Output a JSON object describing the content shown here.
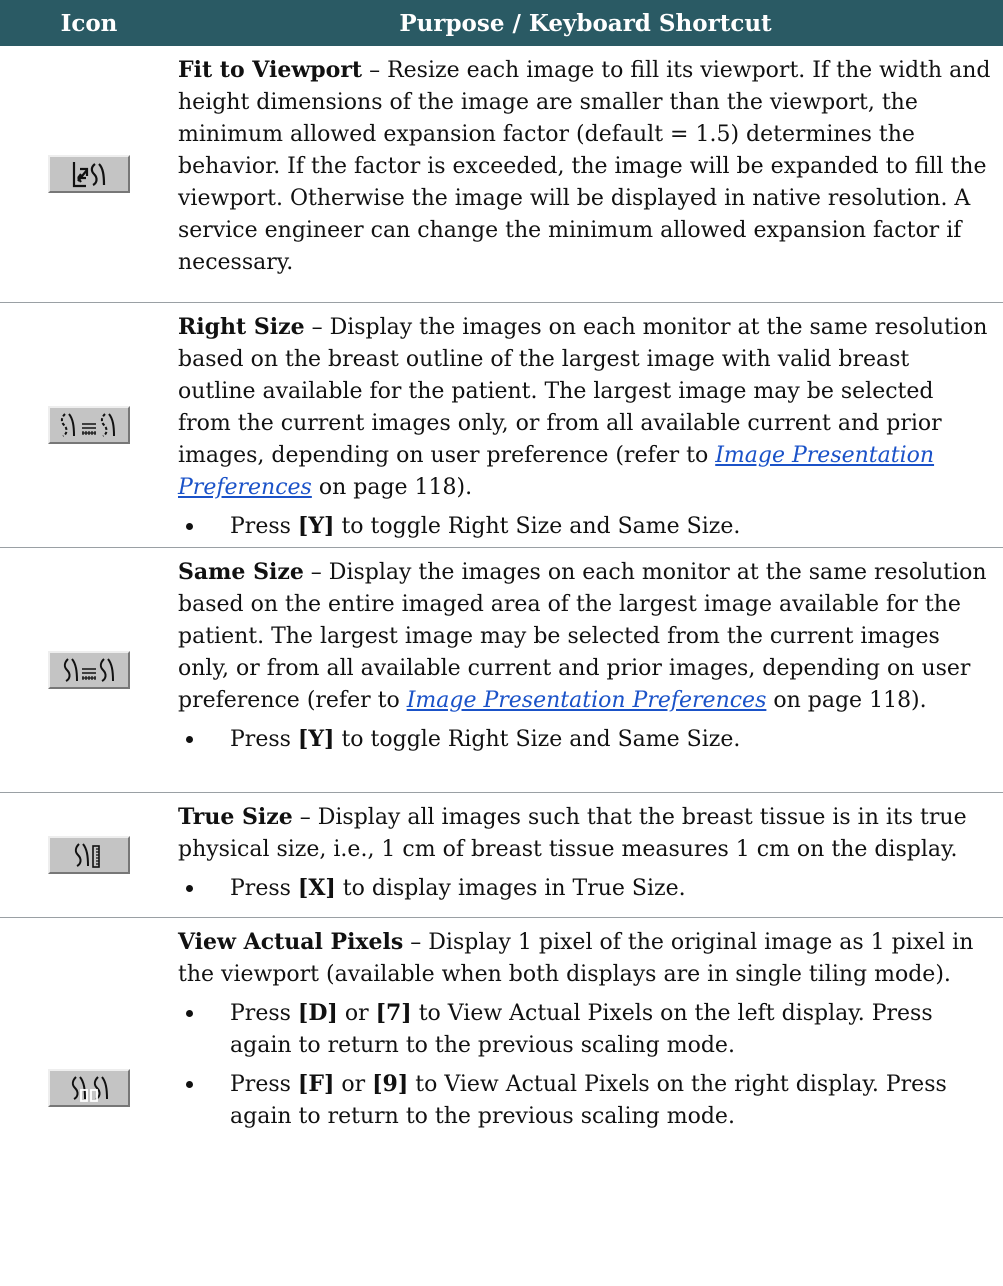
{
  "header": {
    "col_icon": "Icon",
    "col_purpose": "Purpose / Keyboard Shortcut"
  },
  "rows": [
    {
      "icon": "fit-to-viewport-icon",
      "term": "Fit to Viewport",
      "desc": " – Resize each image to fill its viewport. If the width and height dimensions of the image are smaller than the viewport, the minimum allowed expansion factor (default = 1.5) determines the behavior. If the factor is exceeded, the image will be expanded to fill the viewport. Otherwise the image will be displayed in native resolution. A service engineer can change the minimum allowed expansion factor if necessary."
    },
    {
      "icon": "right-size-icon",
      "term": "Right Size",
      "desc": " – Display the images on each monitor at the same resolution based on the breast outline of the largest image with valid breast outline available for the patient. The largest image may be selected from the current images only, or from all available current and prior images, depending on user preference (refer to ",
      "link": "Image Presentation Preferences",
      "after_link": " on page 118).",
      "bullet": {
        "pre": "Press ",
        "key": "[Y]",
        "post": " to toggle Right Size and Same Size."
      }
    },
    {
      "icon": "same-size-icon",
      "term": "Same Size",
      "desc": " – Display the images on each monitor at the same resolution based on the entire imaged area of the largest image available for the patient. The largest image may be selected from the current images only, or from all available current and prior images, depending on user preference (refer to ",
      "link": "Image Presentation Preferences",
      "after_link": " on page 118).",
      "bullet": {
        "pre": "Press ",
        "key": "[Y]",
        "post": " to toggle Right Size and Same Size."
      }
    },
    {
      "icon": "true-size-icon",
      "term": "True Size",
      "desc": " – Display all images such that the breast tissue is in its true physical size, i.e., 1 cm of breast tissue measures 1 cm on the display.",
      "bullet": {
        "pre": "Press ",
        "key": "[X]",
        "post": " to display images in True Size."
      }
    },
    {
      "icon": "view-actual-pixels-icon",
      "term": "View Actual Pixels",
      "desc": " – Display 1 pixel of the original image as 1 pixel in the viewport (available when both displays are in single tiling mode).",
      "bullets": [
        {
          "pre": "Press ",
          "key1": "[D]",
          "mid": " or ",
          "key2": "[7]",
          "post": " to View Actual Pixels on the left display. Press again to return to the previous scaling mode."
        },
        {
          "pre": "Press ",
          "key1": "[F]",
          "mid": " or ",
          "key2": "[9]",
          "post": " to View Actual Pixels on the right display. Press again to return to the previous scaling mode."
        }
      ]
    }
  ]
}
